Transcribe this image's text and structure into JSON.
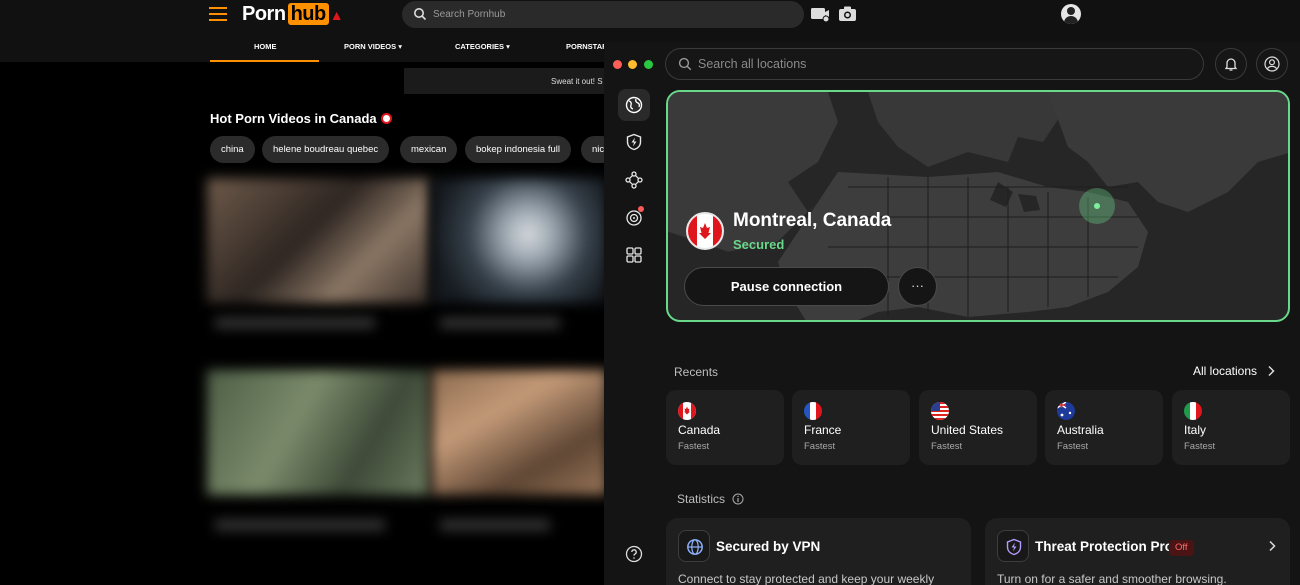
{
  "site": {
    "logo_part1": "Porn",
    "logo_part2": "hub",
    "search_placeholder": "Search Pornhub",
    "icons": [
      "hamburger-icon",
      "upload-icon",
      "camera-icon",
      "account-icon"
    ],
    "nav": [
      "HOME",
      "PORN VIDEOS",
      "CATEGORIES",
      "PORNSTAR"
    ],
    "banner_text": "Sweat it out! S",
    "section_title": "Hot Porn Videos in Canada",
    "tags": [
      "china",
      "helene boudreau quebec",
      "mexican",
      "bokep indonesia full",
      "nic"
    ],
    "accent": "#ff9000"
  },
  "vpn": {
    "search_placeholder": "Search all locations",
    "connection": {
      "location": "Montreal, Canada",
      "status": "Secured",
      "pause_label": "Pause connection",
      "more_label": "···"
    },
    "recents_label": "Recents",
    "all_locations_label": "All locations",
    "recents": [
      {
        "name": "Canada",
        "sub": "Fastest"
      },
      {
        "name": "France",
        "sub": "Fastest"
      },
      {
        "name": "United States",
        "sub": "Fastest"
      },
      {
        "name": "Australia",
        "sub": "Fastest"
      },
      {
        "name": "Italy",
        "sub": "Fastest"
      }
    ],
    "statistics_label": "Statistics",
    "stats": [
      {
        "title": "Secured by VPN",
        "desc": "Connect to stay protected and keep your weekly"
      },
      {
        "title": "Threat Protection Pro",
        "badge": "Off",
        "desc": "Turn on for a safer and smoother browsing."
      }
    ],
    "colors": {
      "accent_green": "#6ad88a",
      "off_red": "#ff6b6b"
    }
  }
}
